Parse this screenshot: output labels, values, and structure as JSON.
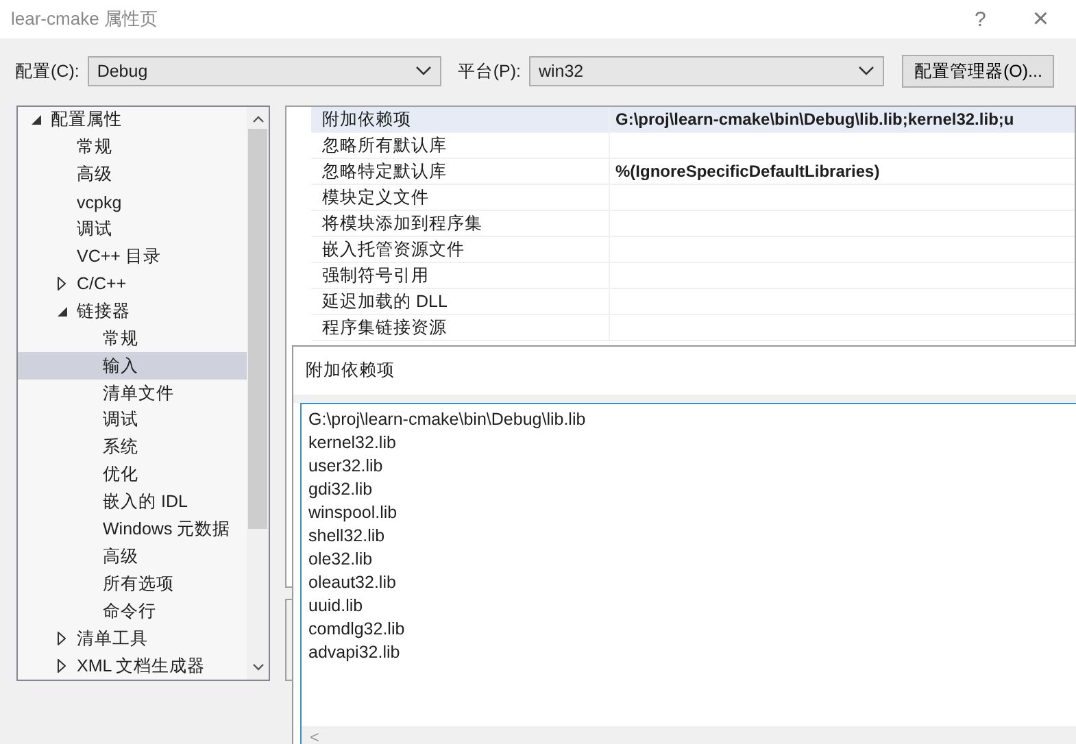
{
  "window": {
    "title": "lear-cmake 属性页",
    "help_button": "?",
    "close_button": "×"
  },
  "config_bar": {
    "configuration": {
      "label": "配置(C):",
      "value": "Debug"
    },
    "platform": {
      "label": "平台(P):",
      "value": "win32"
    },
    "manager_button": "配置管理器(O)..."
  },
  "tree": [
    {
      "label": "配置属性",
      "expanded": true,
      "selected": false,
      "children": [
        {
          "label": "常规",
          "selected": false
        },
        {
          "label": "高级",
          "selected": false
        },
        {
          "label": "vcpkg",
          "selected": false
        },
        {
          "label": "调试",
          "selected": false
        },
        {
          "label": "VC++ 目录",
          "selected": false
        },
        {
          "label": "C/C++",
          "expanded": false,
          "selected": false
        },
        {
          "label": "链接器",
          "expanded": true,
          "selected": false,
          "children": [
            {
              "label": "常规",
              "selected": false
            },
            {
              "label": "输入",
              "selected": true
            },
            {
              "label": "清单文件",
              "selected": false
            },
            {
              "label": "调试",
              "selected": false
            },
            {
              "label": "系统",
              "selected": false
            },
            {
              "label": "优化",
              "selected": false
            },
            {
              "label": "嵌入的 IDL",
              "selected": false
            },
            {
              "label": "Windows 元数据",
              "selected": false
            },
            {
              "label": "高级",
              "selected": false
            },
            {
              "label": "所有选项",
              "selected": false
            },
            {
              "label": "命令行",
              "selected": false
            }
          ]
        },
        {
          "label": "清单工具",
          "expanded": false,
          "selected": false
        },
        {
          "label": "XML 文档生成器",
          "expanded": false,
          "selected": false
        }
      ]
    }
  ],
  "properties": [
    {
      "name": "附加依赖项",
      "value": "G:\\proj\\learn-cmake\\bin\\Debug\\lib.lib;kernel32.lib;u",
      "modified": true,
      "selected": true
    },
    {
      "name": "忽略所有默认库",
      "selected": false
    },
    {
      "name": "忽略特定默认库",
      "value": "%(IgnoreSpecificDefaultLibraries)",
      "modified": true,
      "selected": false
    },
    {
      "name": "模块定义文件",
      "selected": false
    },
    {
      "name": "将模块添加到程序集",
      "selected": false
    },
    {
      "name": "嵌入托管资源文件",
      "selected": false
    },
    {
      "name": "强制符号引用",
      "selected": false
    },
    {
      "name": "延迟加载的 DLL",
      "selected": false
    },
    {
      "name": "程序集链接资源",
      "selected": false
    }
  ],
  "popup": {
    "title": "附加依赖项",
    "lines": [
      "G:\\proj\\learn-cmake\\bin\\Debug\\lib.lib",
      "kernel32.lib",
      "user32.lib",
      "gdi32.lib",
      "winspool.lib",
      "shell32.lib",
      "ole32.lib",
      "oleaut32.lib",
      "uuid.lib",
      "comdlg32.lib",
      "advapi32.lib"
    ],
    "scroll_left": "<"
  }
}
